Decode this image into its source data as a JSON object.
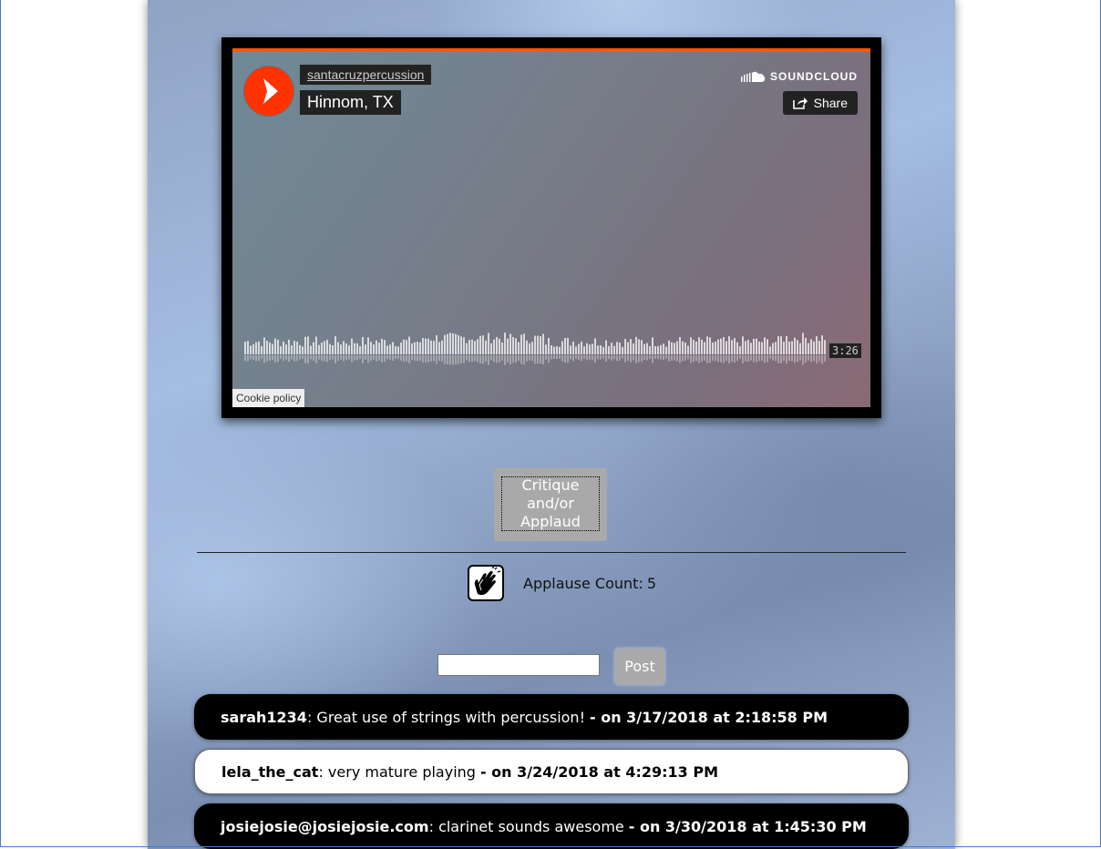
{
  "player": {
    "artist": "santacruzpercussion",
    "track": "Hinnom, TX",
    "brand": "SOUNDCLOUD",
    "share_label": "Share",
    "duration": "3:26",
    "cookie_label": "Cookie policy",
    "accent_color": "#ff5500"
  },
  "actions": {
    "critique_label": "Critique and/or Applaud",
    "applause_label": "Applause Count:",
    "applause_count": "5",
    "comment_value": "",
    "comment_placeholder": "",
    "post_label": "Post"
  },
  "comments": [
    {
      "user": "sarah1234",
      "text": "Great use of strings with percussion!",
      "date": "- on 3/17/2018 at 2:18:58 PM",
      "style": "dark"
    },
    {
      "user": "lela_the_cat",
      "text": "very mature playing",
      "date": "- on 3/24/2018 at 4:29:13 PM",
      "style": "light"
    },
    {
      "user": "josiejosie@josiejosie.com",
      "text": "clarinet sounds awesome",
      "date": "- on 3/30/2018 at 1:45:30 PM",
      "style": "dark"
    }
  ]
}
